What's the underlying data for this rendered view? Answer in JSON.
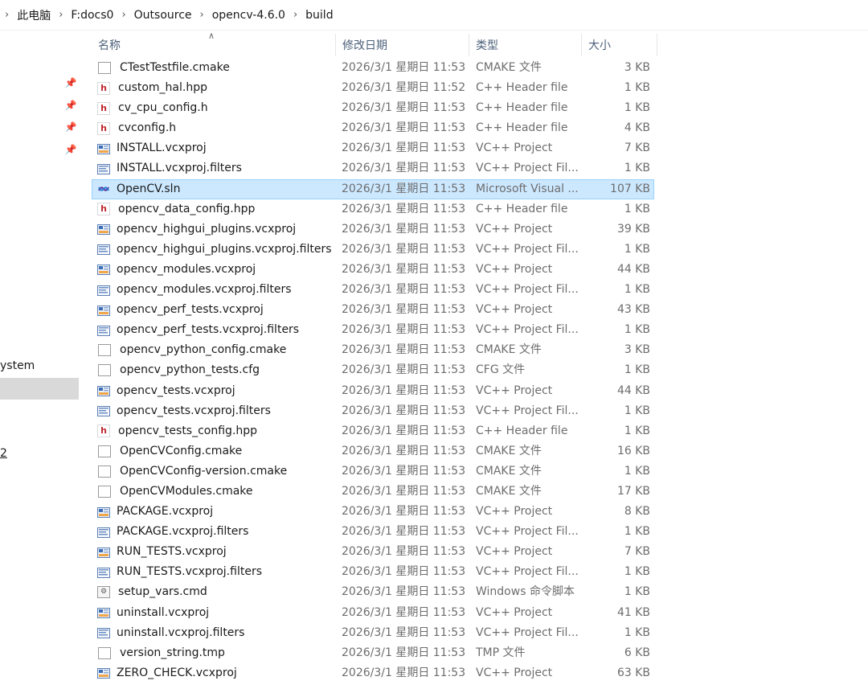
{
  "breadcrumb": [
    "此电脑",
    "F:docs0",
    "Outsource",
    "opencv-4.6.0",
    "build"
  ],
  "nav": {
    "system_label": "ystem",
    "item2_label": "2"
  },
  "columns": {
    "name": "名称",
    "date": "修改日期",
    "type": "类型",
    "size": "大小"
  },
  "selected_index": 6,
  "files": [
    {
      "name": "CTestTestfile.cmake",
      "date": "2026/3/1 星期日 11:53",
      "type": "CMAKE 文件",
      "size": "3 KB",
      "icon": "file-generic-icon"
    },
    {
      "name": "custom_hal.hpp",
      "date": "2026/3/1 星期日 11:52",
      "type": "C++ Header file",
      "size": "1 KB",
      "icon": "cpp-header-icon"
    },
    {
      "name": "cv_cpu_config.h",
      "date": "2026/3/1 星期日 11:53",
      "type": "C++ Header file",
      "size": "1 KB",
      "icon": "cpp-header-icon"
    },
    {
      "name": "cvconfig.h",
      "date": "2026/3/1 星期日 11:53",
      "type": "C++ Header file",
      "size": "4 KB",
      "icon": "cpp-header-icon"
    },
    {
      "name": "INSTALL.vcxproj",
      "date": "2026/3/1 星期日 11:53",
      "type": "VC++ Project",
      "size": "7 KB",
      "icon": "vcxproj-icon"
    },
    {
      "name": "INSTALL.vcxproj.filters",
      "date": "2026/3/1 星期日 11:53",
      "type": "VC++ Project Fil...",
      "size": "1 KB",
      "icon": "vcxproj-filters-icon"
    },
    {
      "name": "OpenCV.sln",
      "date": "2026/3/1 星期日 11:53",
      "type": "Microsoft Visual ...",
      "size": "107 KB",
      "icon": "visual-studio-solution-icon"
    },
    {
      "name": "opencv_data_config.hpp",
      "date": "2026/3/1 星期日 11:53",
      "type": "C++ Header file",
      "size": "1 KB",
      "icon": "cpp-header-icon"
    },
    {
      "name": "opencv_highgui_plugins.vcxproj",
      "date": "2026/3/1 星期日 11:53",
      "type": "VC++ Project",
      "size": "39 KB",
      "icon": "vcxproj-icon"
    },
    {
      "name": "opencv_highgui_plugins.vcxproj.filters",
      "date": "2026/3/1 星期日 11:53",
      "type": "VC++ Project Fil...",
      "size": "1 KB",
      "icon": "vcxproj-filters-icon"
    },
    {
      "name": "opencv_modules.vcxproj",
      "date": "2026/3/1 星期日 11:53",
      "type": "VC++ Project",
      "size": "44 KB",
      "icon": "vcxproj-icon"
    },
    {
      "name": "opencv_modules.vcxproj.filters",
      "date": "2026/3/1 星期日 11:53",
      "type": "VC++ Project Fil...",
      "size": "1 KB",
      "icon": "vcxproj-filters-icon"
    },
    {
      "name": "opencv_perf_tests.vcxproj",
      "date": "2026/3/1 星期日 11:53",
      "type": "VC++ Project",
      "size": "43 KB",
      "icon": "vcxproj-icon"
    },
    {
      "name": "opencv_perf_tests.vcxproj.filters",
      "date": "2026/3/1 星期日 11:53",
      "type": "VC++ Project Fil...",
      "size": "1 KB",
      "icon": "vcxproj-filters-icon"
    },
    {
      "name": "opencv_python_config.cmake",
      "date": "2026/3/1 星期日 11:53",
      "type": "CMAKE 文件",
      "size": "3 KB",
      "icon": "file-generic-icon"
    },
    {
      "name": "opencv_python_tests.cfg",
      "date": "2026/3/1 星期日 11:53",
      "type": "CFG 文件",
      "size": "1 KB",
      "icon": "file-generic-icon"
    },
    {
      "name": "opencv_tests.vcxproj",
      "date": "2026/3/1 星期日 11:53",
      "type": "VC++ Project",
      "size": "44 KB",
      "icon": "vcxproj-icon"
    },
    {
      "name": "opencv_tests.vcxproj.filters",
      "date": "2026/3/1 星期日 11:53",
      "type": "VC++ Project Fil...",
      "size": "1 KB",
      "icon": "vcxproj-filters-icon"
    },
    {
      "name": "opencv_tests_config.hpp",
      "date": "2026/3/1 星期日 11:53",
      "type": "C++ Header file",
      "size": "1 KB",
      "icon": "cpp-header-icon"
    },
    {
      "name": "OpenCVConfig.cmake",
      "date": "2026/3/1 星期日 11:53",
      "type": "CMAKE 文件",
      "size": "16 KB",
      "icon": "file-generic-icon"
    },
    {
      "name": "OpenCVConfig-version.cmake",
      "date": "2026/3/1 星期日 11:53",
      "type": "CMAKE 文件",
      "size": "1 KB",
      "icon": "file-generic-icon"
    },
    {
      "name": "OpenCVModules.cmake",
      "date": "2026/3/1 星期日 11:53",
      "type": "CMAKE 文件",
      "size": "17 KB",
      "icon": "file-generic-icon"
    },
    {
      "name": "PACKAGE.vcxproj",
      "date": "2026/3/1 星期日 11:53",
      "type": "VC++ Project",
      "size": "8 KB",
      "icon": "vcxproj-icon"
    },
    {
      "name": "PACKAGE.vcxproj.filters",
      "date": "2026/3/1 星期日 11:53",
      "type": "VC++ Project Fil...",
      "size": "1 KB",
      "icon": "vcxproj-filters-icon"
    },
    {
      "name": "RUN_TESTS.vcxproj",
      "date": "2026/3/1 星期日 11:53",
      "type": "VC++ Project",
      "size": "7 KB",
      "icon": "vcxproj-icon"
    },
    {
      "name": "RUN_TESTS.vcxproj.filters",
      "date": "2026/3/1 星期日 11:53",
      "type": "VC++ Project Fil...",
      "size": "1 KB",
      "icon": "vcxproj-filters-icon"
    },
    {
      "name": "setup_vars.cmd",
      "date": "2026/3/1 星期日 11:53",
      "type": "Windows 命令脚本",
      "size": "1 KB",
      "icon": "cmd-script-icon"
    },
    {
      "name": "uninstall.vcxproj",
      "date": "2026/3/1 星期日 11:53",
      "type": "VC++ Project",
      "size": "41 KB",
      "icon": "vcxproj-icon"
    },
    {
      "name": "uninstall.vcxproj.filters",
      "date": "2026/3/1 星期日 11:53",
      "type": "VC++ Project Fil...",
      "size": "1 KB",
      "icon": "vcxproj-filters-icon"
    },
    {
      "name": "version_string.tmp",
      "date": "2026/3/1 星期日 11:53",
      "type": "TMP 文件",
      "size": "6 KB",
      "icon": "file-generic-icon"
    },
    {
      "name": "ZERO_CHECK.vcxproj",
      "date": "2026/3/1 星期日 11:53",
      "type": "VC++ Project",
      "size": "63 KB",
      "icon": "vcxproj-icon"
    }
  ]
}
